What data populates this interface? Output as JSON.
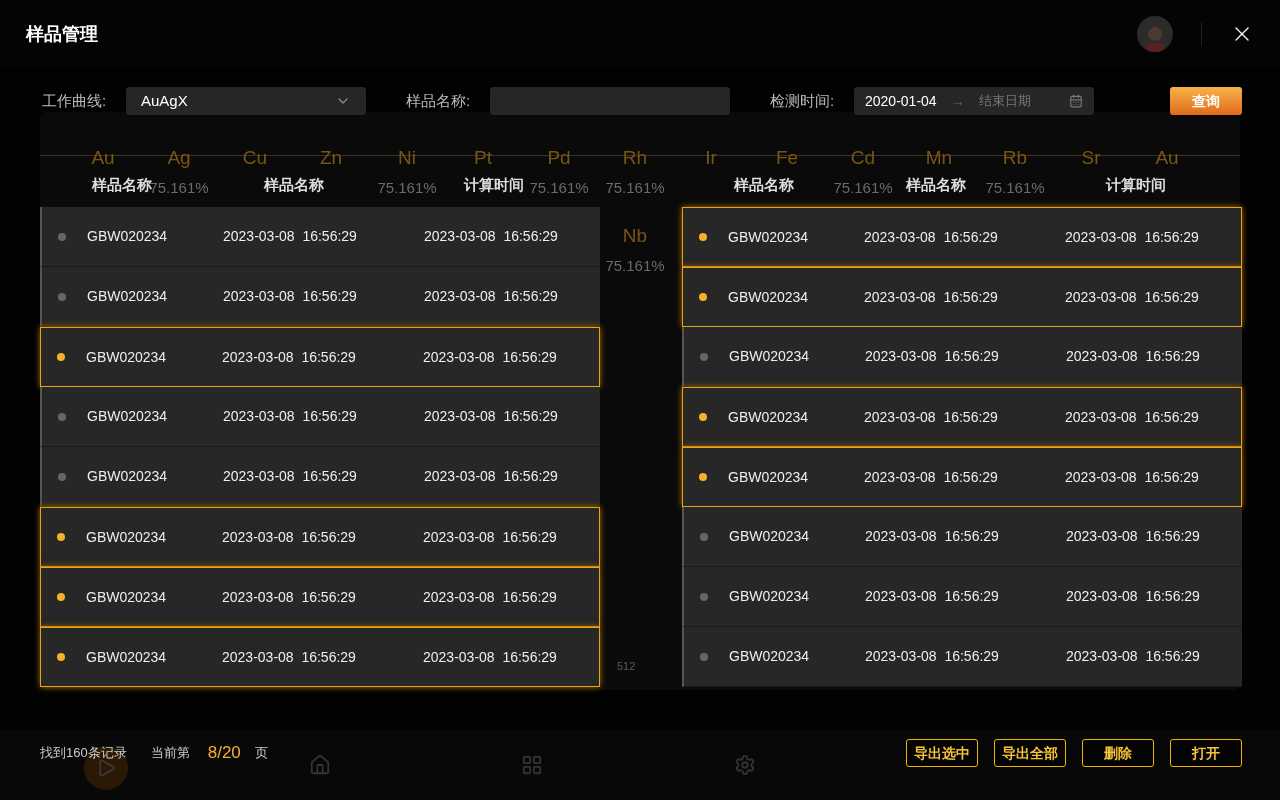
{
  "background": {
    "elements": [
      {
        "symbol": "Au"
      },
      {
        "symbol": "Ag",
        "value": "75.161%"
      },
      {
        "symbol": "Cu"
      },
      {
        "symbol": "Zn"
      },
      {
        "symbol": "Ni",
        "value": "75.161%"
      },
      {
        "symbol": "Pt"
      },
      {
        "symbol": "Pd",
        "value": "75.161%"
      },
      {
        "symbol": "Rh",
        "value": "75.161%"
      },
      {
        "symbol": "Ir"
      },
      {
        "symbol": "Fe"
      },
      {
        "symbol": "Cd",
        "value": "75.161%"
      },
      {
        "symbol": "Mn"
      },
      {
        "symbol": "Rb",
        "value": "75.161%"
      },
      {
        "symbol": "Sr"
      },
      {
        "symbol": "Au"
      }
    ],
    "extra_element": {
      "symbol": "Nb",
      "value": "75.161%"
    },
    "axis_label": "512"
  },
  "window": {
    "title": "样品管理"
  },
  "filters": {
    "curve": {
      "label": "工作曲线:",
      "value": "AuAgX"
    },
    "name": {
      "label": "样品名称:"
    },
    "date": {
      "label": "检测时间:",
      "start": "2020-01-04",
      "arrow": "→",
      "end_placeholder": "结束日期"
    },
    "query_button": "查询"
  },
  "tables": [
    {
      "columns": [
        "样品名称",
        "样品名称",
        "计算时间"
      ],
      "rows": [
        {
          "name": "GBW020234",
          "created": "2023-03-08  16:56:29",
          "computed": "2023-03-08  16:56:29",
          "selected": false
        },
        {
          "name": "GBW020234",
          "created": "2023-03-08  16:56:29",
          "computed": "2023-03-08  16:56:29",
          "selected": false
        },
        {
          "name": "GBW020234",
          "created": "2023-03-08  16:56:29",
          "computed": "2023-03-08  16:56:29",
          "selected": true
        },
        {
          "name": "GBW020234",
          "created": "2023-03-08  16:56:29",
          "computed": "2023-03-08  16:56:29",
          "selected": false
        },
        {
          "name": "GBW020234",
          "created": "2023-03-08  16:56:29",
          "computed": "2023-03-08  16:56:29",
          "selected": false
        },
        {
          "name": "GBW020234",
          "created": "2023-03-08  16:56:29",
          "computed": "2023-03-08  16:56:29",
          "selected": true
        },
        {
          "name": "GBW020234",
          "created": "2023-03-08  16:56:29",
          "computed": "2023-03-08  16:56:29",
          "selected": true
        },
        {
          "name": "GBW020234",
          "created": "2023-03-08  16:56:29",
          "computed": "2023-03-08  16:56:29",
          "selected": true
        }
      ]
    },
    {
      "columns": [
        "样品名称",
        "样品名称",
        "计算时间"
      ],
      "rows": [
        {
          "name": "GBW020234",
          "created": "2023-03-08  16:56:29",
          "computed": "2023-03-08  16:56:29",
          "selected": true
        },
        {
          "name": "GBW020234",
          "created": "2023-03-08  16:56:29",
          "computed": "2023-03-08  16:56:29",
          "selected": true
        },
        {
          "name": "GBW020234",
          "created": "2023-03-08  16:56:29",
          "computed": "2023-03-08  16:56:29",
          "selected": false
        },
        {
          "name": "GBW020234",
          "created": "2023-03-08  16:56:29",
          "computed": "2023-03-08  16:56:29",
          "selected": true
        },
        {
          "name": "GBW020234",
          "created": "2023-03-08  16:56:29",
          "computed": "2023-03-08  16:56:29",
          "selected": true
        },
        {
          "name": "GBW020234",
          "created": "2023-03-08  16:56:29",
          "computed": "2023-03-08  16:56:29",
          "selected": false
        },
        {
          "name": "GBW020234",
          "created": "2023-03-08  16:56:29",
          "computed": "2023-03-08  16:56:29",
          "selected": false
        },
        {
          "name": "GBW020234",
          "created": "2023-03-08  16:56:29",
          "computed": "2023-03-08  16:56:29",
          "selected": false
        }
      ]
    }
  ],
  "footer": {
    "records": "找到160条记录",
    "page_prefix": "当前第",
    "page": "8/20",
    "page_suffix": "页",
    "buttons": [
      "导出选中",
      "导出全部",
      "删除",
      "打开"
    ]
  }
}
